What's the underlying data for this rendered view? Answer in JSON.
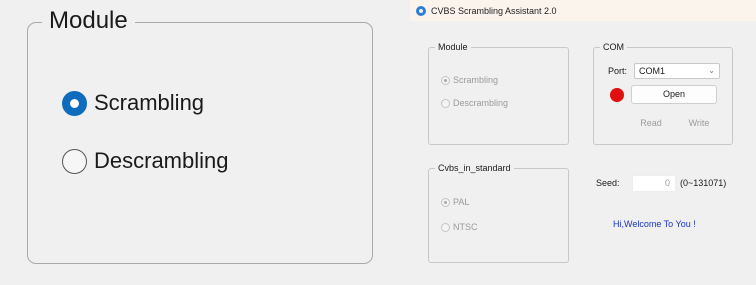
{
  "zoom": {
    "legend": "Module",
    "options": [
      {
        "label": "Scrambling",
        "checked": true
      },
      {
        "label": "Descrambling",
        "checked": false
      }
    ]
  },
  "window": {
    "title": "CVBS Scrambling Assistant 2.0",
    "icon": "gear-icon"
  },
  "module": {
    "legend": "Module",
    "options": [
      {
        "label": "Scrambling",
        "checked": true
      },
      {
        "label": "Descrambling",
        "checked": false
      }
    ]
  },
  "com": {
    "legend": "COM",
    "port_label": "Port:",
    "port_value": "COM1",
    "status_color": "#e01010",
    "open_label": "Open",
    "read_label": "Read",
    "write_label": "Write"
  },
  "standard": {
    "legend": "Cvbs_in_standard",
    "options": [
      {
        "label": "PAL",
        "checked": true
      },
      {
        "label": "NTSC",
        "checked": false
      }
    ]
  },
  "seed": {
    "label": "Seed:",
    "value": "0",
    "range": "(0~131071)"
  },
  "status": {
    "welcome": "Hi,Welcome To You !"
  }
}
